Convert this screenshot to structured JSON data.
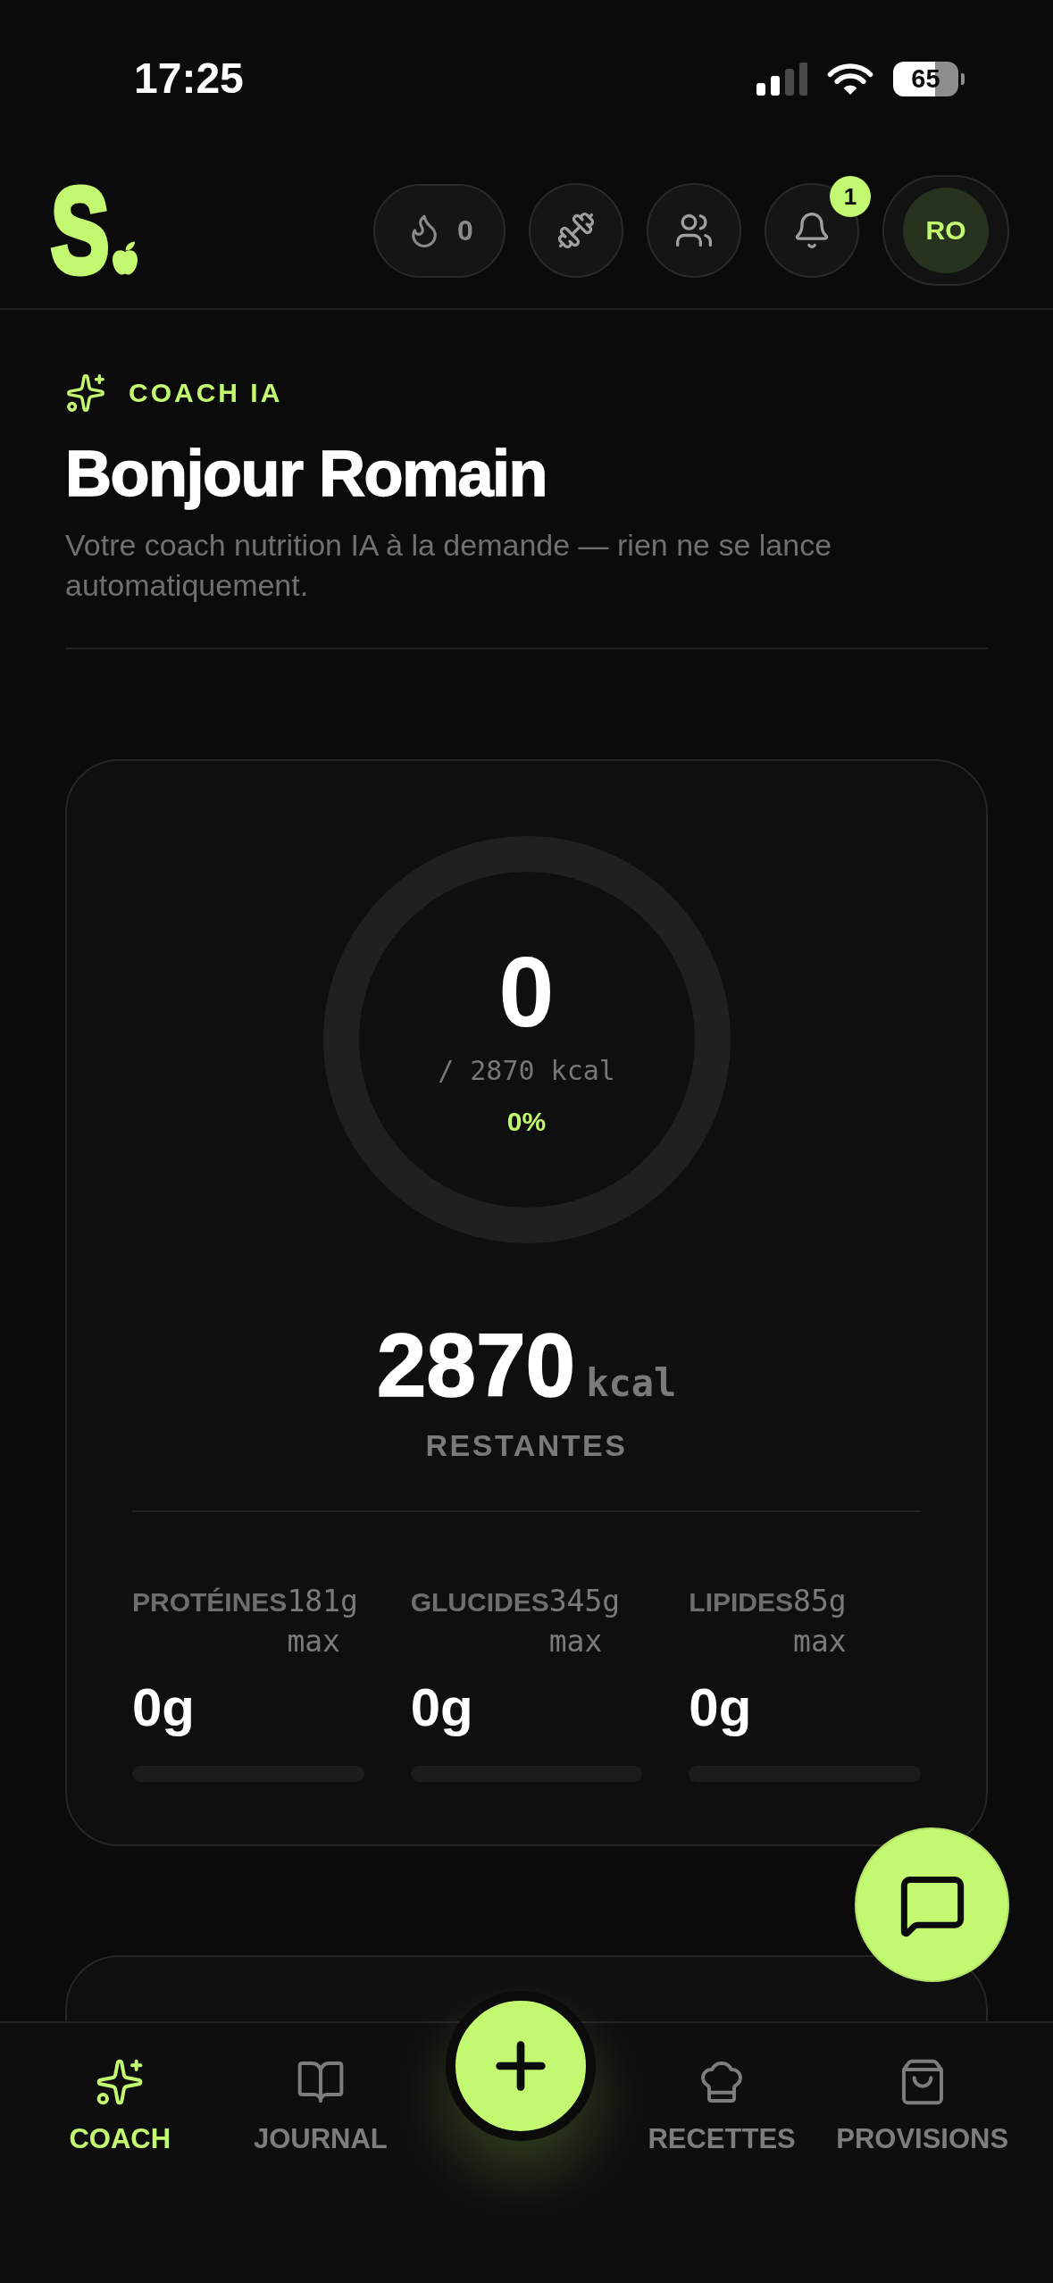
{
  "status_bar": {
    "time": "17:25",
    "battery": "65"
  },
  "header": {
    "logo": "S",
    "streak_count": "0",
    "notification_badge": "1",
    "avatar_initials": "RO"
  },
  "intro": {
    "eyebrow": "COACH IA",
    "title": "Bonjour Romain",
    "subtitle": "Votre coach nutrition IA à la demande — rien ne se lance automatiquement."
  },
  "calorie_card": {
    "consumed": "0",
    "goal": "/ 2870 kcal",
    "percent": "0%",
    "remaining": "2870",
    "remaining_unit": "kcal",
    "remaining_label": "RESTANTES"
  },
  "macros": [
    {
      "name": "PROTÉINES",
      "target": "181g max",
      "value": "0g",
      "level": 0
    },
    {
      "name": "GLUCIDES",
      "target": "345g max",
      "value": "0g",
      "level": 0
    },
    {
      "name": "LIPIDES",
      "target": "85g max",
      "value": "0g",
      "level": 0
    }
  ],
  "bottom_nav": {
    "tabs": [
      {
        "label": "COACH",
        "selected": true
      },
      {
        "label": "JOURNAL",
        "selected": false
      },
      {
        "label": "RECETTES",
        "selected": false
      },
      {
        "label": "PROVISIONS",
        "selected": false
      }
    ]
  }
}
